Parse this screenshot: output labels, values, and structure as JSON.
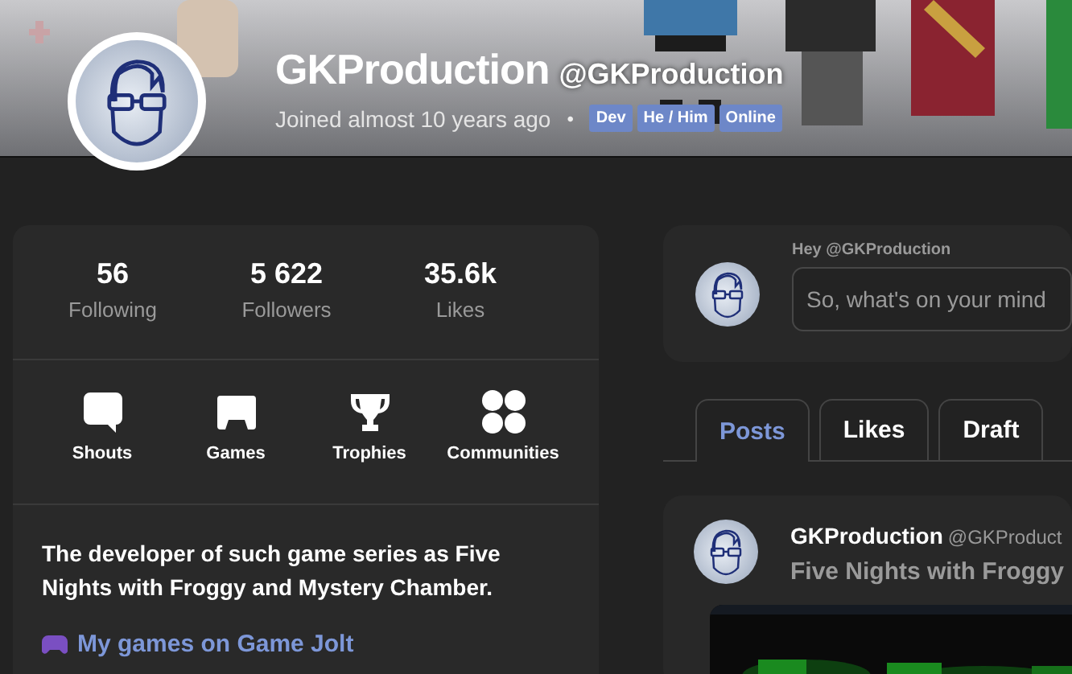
{
  "user": {
    "name": "GKProduction",
    "handle": "@GKProduction",
    "joined": "Joined almost 10 years ago",
    "separator": "•",
    "tags": [
      "Dev",
      "He / Him",
      "Online"
    ]
  },
  "stats": [
    {
      "value": "56",
      "label": "Following"
    },
    {
      "value": "5 622",
      "label": "Followers"
    },
    {
      "value": "35.6k",
      "label": "Likes"
    }
  ],
  "sections": [
    {
      "kind": "shouts",
      "label": "Shouts"
    },
    {
      "kind": "games",
      "label": "Games"
    },
    {
      "kind": "trophies",
      "label": "Trophies"
    },
    {
      "kind": "communities",
      "label": "Communities"
    }
  ],
  "bio": "The developer of such game series as Five Nights with Froggy and Mystery Chamber.",
  "link": {
    "label": "My games on Game Jolt"
  },
  "composer": {
    "greeting": "Hey @GKProduction",
    "placeholder": "So, what's on your mind"
  },
  "tabs": [
    {
      "label": "Posts",
      "selected": true
    },
    {
      "label": "Likes",
      "selected": false
    },
    {
      "label": "Draft",
      "selected": false
    }
  ],
  "post": {
    "author": "GKProduction",
    "handle": "@GKProduct",
    "title": "Five Nights with Froggy"
  }
}
